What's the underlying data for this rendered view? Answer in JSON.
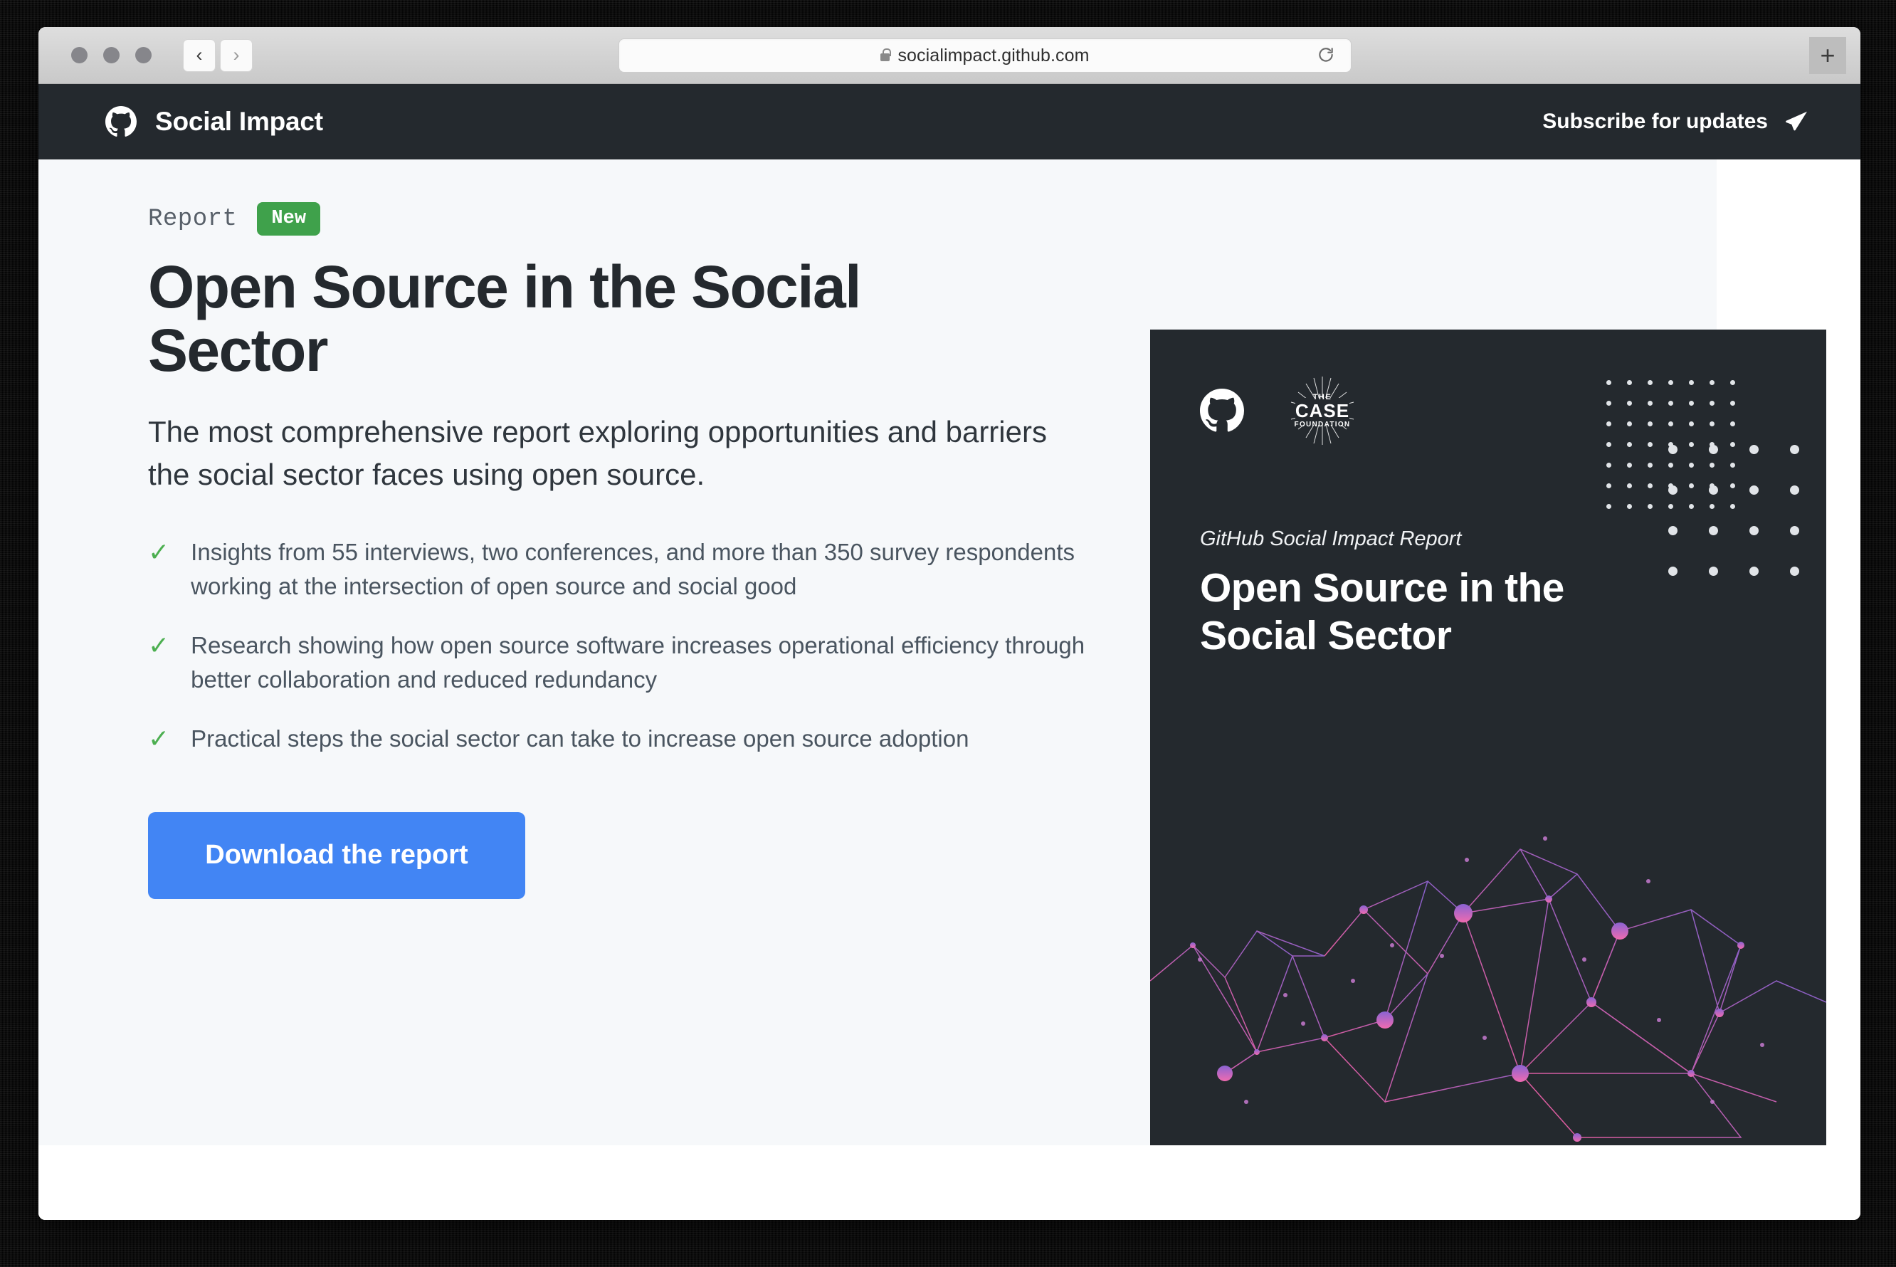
{
  "browser": {
    "traffic_lights": [
      "close",
      "minimize",
      "zoom"
    ],
    "back_label": "‹",
    "forward_label": "›",
    "url": "socialimpact.github.com",
    "secure": true,
    "reload_icon": "reload-icon",
    "newtab_label": "+"
  },
  "site_header": {
    "logo_icon": "github-octocat-icon",
    "brand": "Social Impact",
    "subscribe_label": "Subscribe for updates",
    "subscribe_icon": "paper-plane-icon"
  },
  "hero": {
    "kicker": "Report",
    "badge": "New",
    "headline": "Open Source in the Social Sector",
    "subhead": "The most comprehensive report exploring opportunities and barriers the social sector faces using open source.",
    "bullets": [
      {
        "icon": "check-icon",
        "text": "Insights from 55 interviews, two conferences, and more than 350 survey respondents working at the intersection of open source and social good"
      },
      {
        "icon": "check-icon",
        "text": "Research showing how open source software increases operational efficiency through better collaboration and reduced redundancy"
      },
      {
        "icon": "check-icon",
        "text": "Practical steps the social sector can take to increase open source adoption"
      }
    ],
    "download_label": "Download the report"
  },
  "cover": {
    "github_icon": "github-octocat-icon",
    "partner_logo": {
      "icon": "case-foundation-logo",
      "line1": "THE",
      "line2": "CASE",
      "line3": "FOUNDATION"
    },
    "eyebrow": "GitHub Social Impact Report",
    "title": "Open Source in the Social Sector",
    "decoration": "dot-grid-and-network-mesh"
  },
  "colors": {
    "header_bg": "#24292e",
    "panel_bg": "#f6f8fa",
    "badge_green": "#3fa14b",
    "check_green": "#4caf50",
    "button_blue": "#4285f4",
    "heading": "#24292e",
    "body_text": "#4a5560",
    "network_pink": "#ef5ba1",
    "network_purple": "#8a63d2"
  }
}
